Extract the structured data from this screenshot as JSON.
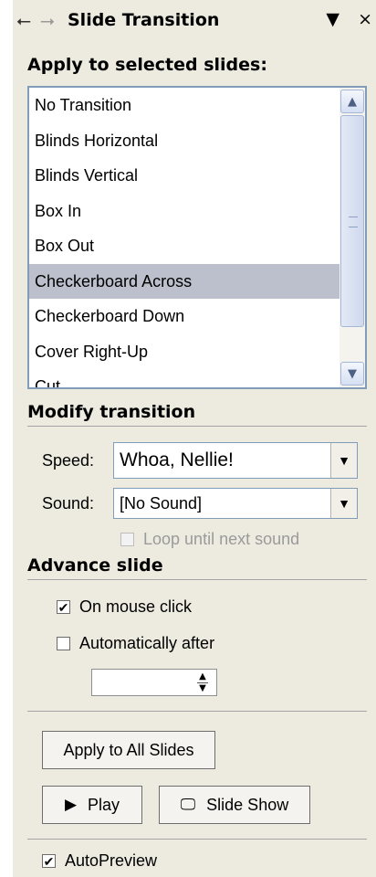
{
  "titlebar": {
    "back_icon": "back-arrow-icon",
    "forward_icon": "forward-arrow-icon",
    "title": "Slide Transition",
    "menu_icon": "▼",
    "close_icon": "×"
  },
  "apply_label": "Apply to selected slides:",
  "transitions": [
    "No Transition",
    "Blinds Horizontal",
    "Blinds Vertical",
    "Box In",
    "Box Out",
    "Checkerboard Across",
    "Checkerboard Down",
    "Cover Right-Up",
    "Cut"
  ],
  "selected_transition": "Checkerboard Across",
  "modify": {
    "heading": "Modify transition",
    "speed_label": "Speed:",
    "speed_value": "Whoa, Nellie!",
    "sound_label": "Sound:",
    "sound_value": "[No Sound]",
    "loop_label": "Loop until next sound",
    "loop_checked": false
  },
  "advance": {
    "heading": "Advance slide",
    "mouse_label": "On mouse click",
    "mouse_checked": true,
    "auto_label": "Automatically after",
    "auto_checked": false,
    "auto_value": ""
  },
  "buttons": {
    "apply_all": "Apply to All Slides",
    "play": "Play",
    "slide_show": "Slide Show"
  },
  "autopreview": {
    "label": "AutoPreview",
    "checked": true
  }
}
